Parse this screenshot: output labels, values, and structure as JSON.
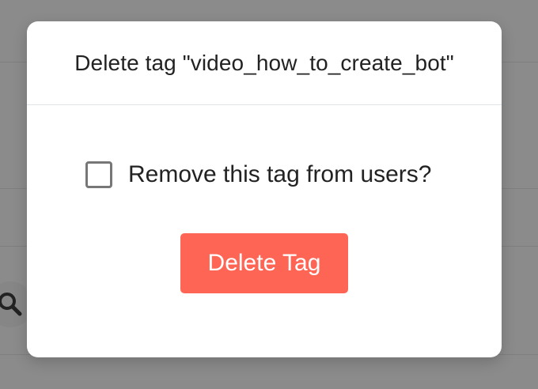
{
  "dialog": {
    "title": "Delete tag \"video_how_to_create_bot\"",
    "checkbox_label": "Remove this tag from users?",
    "checkbox_checked": false,
    "delete_button_label": "Delete Tag"
  },
  "background": {
    "search_icon": "search-icon"
  },
  "colors": {
    "overlay": "#8b8b8b",
    "dialog_bg": "#ffffff",
    "delete_button": "#ff6554",
    "divider": "#dfe3ea"
  }
}
